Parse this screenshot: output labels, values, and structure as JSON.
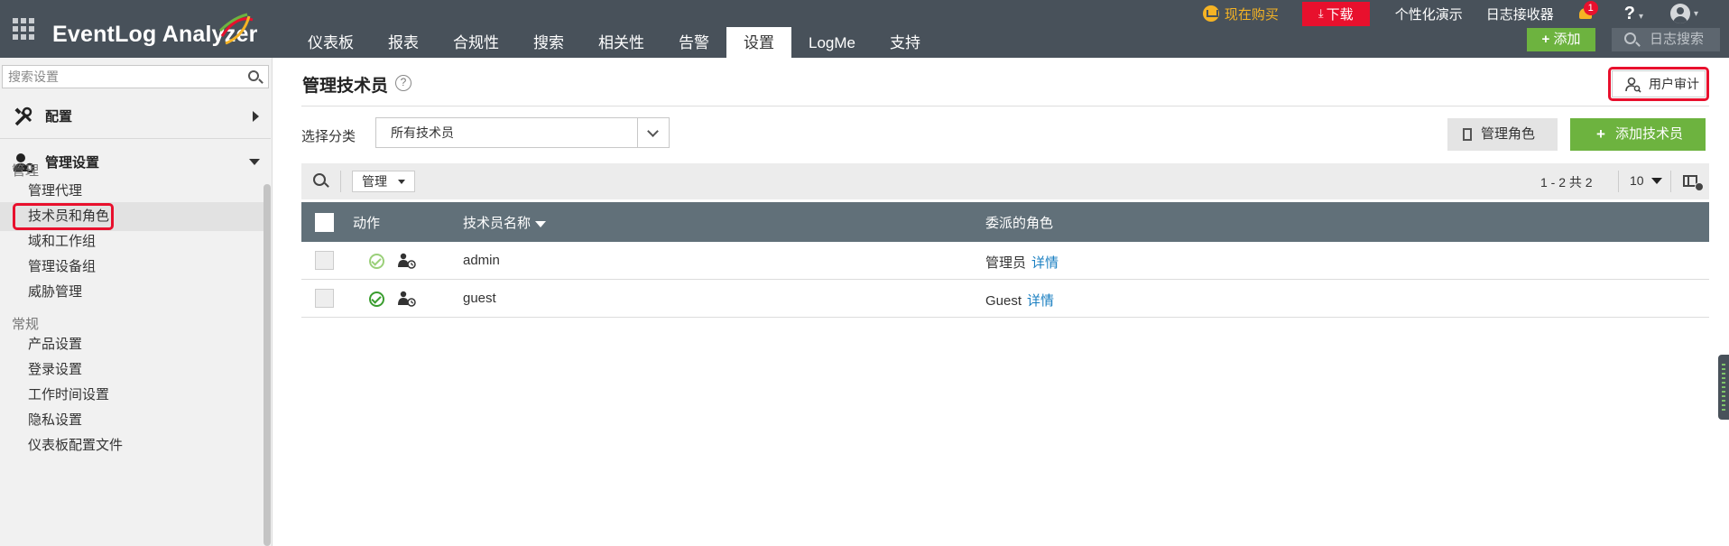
{
  "app": {
    "logo_text": "EventLog Analyzer"
  },
  "nav": {
    "tabs": [
      {
        "label": "仪表板"
      },
      {
        "label": "报表"
      },
      {
        "label": "合规性"
      },
      {
        "label": "搜索"
      },
      {
        "label": "相关性"
      },
      {
        "label": "告警"
      },
      {
        "label": "设置",
        "active": true
      },
      {
        "label": "LogMe"
      },
      {
        "label": "支持"
      }
    ]
  },
  "top_links": {
    "buy": "现在购买",
    "download": "下载",
    "personalize": "个性化演示",
    "log_receiver": "日志接收器",
    "notification_count": "1",
    "help": "?",
    "add": "添加",
    "log_search_placeholder": "日志搜索"
  },
  "sidebar": {
    "search_placeholder": "搜索设置",
    "sections": [
      {
        "label": "配置",
        "icon": "tools-icon",
        "expanded": false
      },
      {
        "label": "管理设置",
        "icon": "user-gear-icon",
        "expanded": true
      }
    ],
    "groups": [
      {
        "title": "管理",
        "items": [
          {
            "label": "管理代理"
          },
          {
            "label": "技术员和角色",
            "active": true
          },
          {
            "label": "域和工作组"
          },
          {
            "label": "管理设备组"
          },
          {
            "label": "威胁管理"
          }
        ]
      },
      {
        "title": "常规",
        "items": [
          {
            "label": "产品设置"
          },
          {
            "label": "登录设置"
          },
          {
            "label": "工作时间设置"
          },
          {
            "label": "隐私设置"
          },
          {
            "label": "仪表板配置文件"
          }
        ]
      }
    ]
  },
  "main": {
    "title": "管理技术员",
    "audit_button": "用户审计",
    "category_label": "选择分类",
    "category_value": "所有技术员",
    "manage_roles_button": "管理角色",
    "add_tech_button": "添加技术员",
    "toolbar": {
      "manage_label": "管理",
      "pager_text": "1 - 2 共 2",
      "per_page": "10"
    },
    "table": {
      "columns": [
        "动作",
        "技术员名称",
        "委派的角色"
      ],
      "rows": [
        {
          "name": "admin",
          "role": "管理员",
          "role_link": "详情",
          "enabled": false
        },
        {
          "name": "guest",
          "role": "Guest",
          "role_link": "详情",
          "enabled": true
        }
      ]
    }
  },
  "colors": {
    "topbar": "#48515a",
    "accent_green": "#6db33f",
    "download_red": "#e8102d",
    "buy_orange": "#f5b324",
    "table_header": "#617079",
    "link_blue": "#1a7fc1",
    "highlight_red": "#e8102d"
  }
}
